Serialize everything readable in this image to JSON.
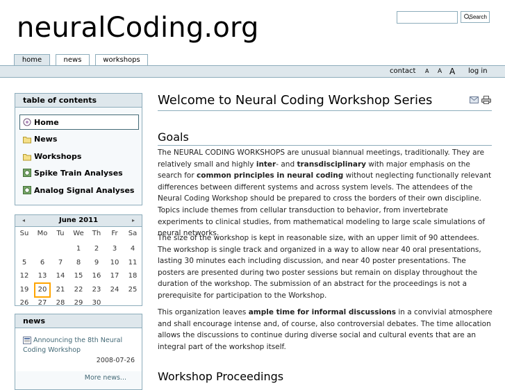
{
  "site": {
    "logo": "neuralCoding.org"
  },
  "search": {
    "button_label": "Search",
    "value": ""
  },
  "tabs": [
    {
      "label": "home",
      "active": true
    },
    {
      "label": "news",
      "active": false
    },
    {
      "label": "workshops",
      "active": false
    }
  ],
  "personal_bar": {
    "contact": "contact",
    "size_small": "A",
    "size_medium": "A",
    "size_large": "A",
    "login": "log in"
  },
  "toc": {
    "title": "table of contents",
    "items": [
      {
        "label": "Home",
        "icon": "home-icon"
      },
      {
        "label": "News",
        "icon": "folder-icon"
      },
      {
        "label": "Workshops",
        "icon": "folder-icon"
      },
      {
        "label": "Spike Train Analyses",
        "icon": "link-icon"
      },
      {
        "label": "Analog Signal Analyses",
        "icon": "link-icon"
      }
    ]
  },
  "calendar": {
    "title": "June 2011",
    "prev": "◂",
    "next": "▸",
    "weekdays": [
      "Su",
      "Mo",
      "Tu",
      "We",
      "Th",
      "Fr",
      "Sa"
    ],
    "weeks": [
      [
        "",
        "",
        "",
        "1",
        "2",
        "3",
        "4"
      ],
      [
        "5",
        "6",
        "7",
        "8",
        "9",
        "10",
        "11"
      ],
      [
        "12",
        "13",
        "14",
        "15",
        "16",
        "17",
        "18"
      ],
      [
        "19",
        "20",
        "21",
        "22",
        "23",
        "24",
        "25"
      ],
      [
        "26",
        "27",
        "28",
        "29",
        "30",
        "",
        ""
      ]
    ],
    "today": "20"
  },
  "news": {
    "title": "news",
    "item_title": "Announcing the 8th Neural Coding Workshop",
    "item_date": "2008-07-26",
    "more": "More news..."
  },
  "main": {
    "title": "Welcome to Neural Coding Workshop Series",
    "goals_heading": "Goals",
    "proceedings_heading": "Workshop Proceedings",
    "p1": {
      "t1": "The NEURAL CODING WORKSHOPS are unusual biannual meetings, traditionally. They are relatively small and highly ",
      "b1": "inter",
      "t2": "- and ",
      "b2": "transdisciplinary",
      "t3": " with major emphasis on the search for ",
      "b3": "common principles in neural coding",
      "t4": " without neglecting functionally relevant differences between different systems and across system levels. The attendees of the Neural Coding Workshop should be prepared to cross the borders of their own discipline. Topics include themes from cellular transduction to behavior, from invertebrate experiments to clinical studies, from mathematical modeling to large scale simulations of neural networks."
    },
    "p2": "The size of the workshop is kept in reasonable size, with an upper limit of 90 attendees. The workshop is single track and organized in a way to allow near 40 oral presentations, lasting 30 minutes each including discussion, and near 40 poster presentations. The posters are presented during two poster sessions but remain on display throughout the duration of the workshop. The submission of an abstract for the proceedings is not a prerequisite for participation to the Workshop.",
    "p3": {
      "t1": "This organization leaves ",
      "b1": "ample time for informal discussions",
      "t2": " in a convivial atmosphere and shall encourage intense and, of course, also controversial debates. The time allocation allows the discussions to continue during diverse social and cultural events that are an integral part of the workshop itself."
    }
  },
  "colors": {
    "accent": "#8cacbb",
    "bar": "#dee7ec",
    "today_border": "#ffa500"
  }
}
